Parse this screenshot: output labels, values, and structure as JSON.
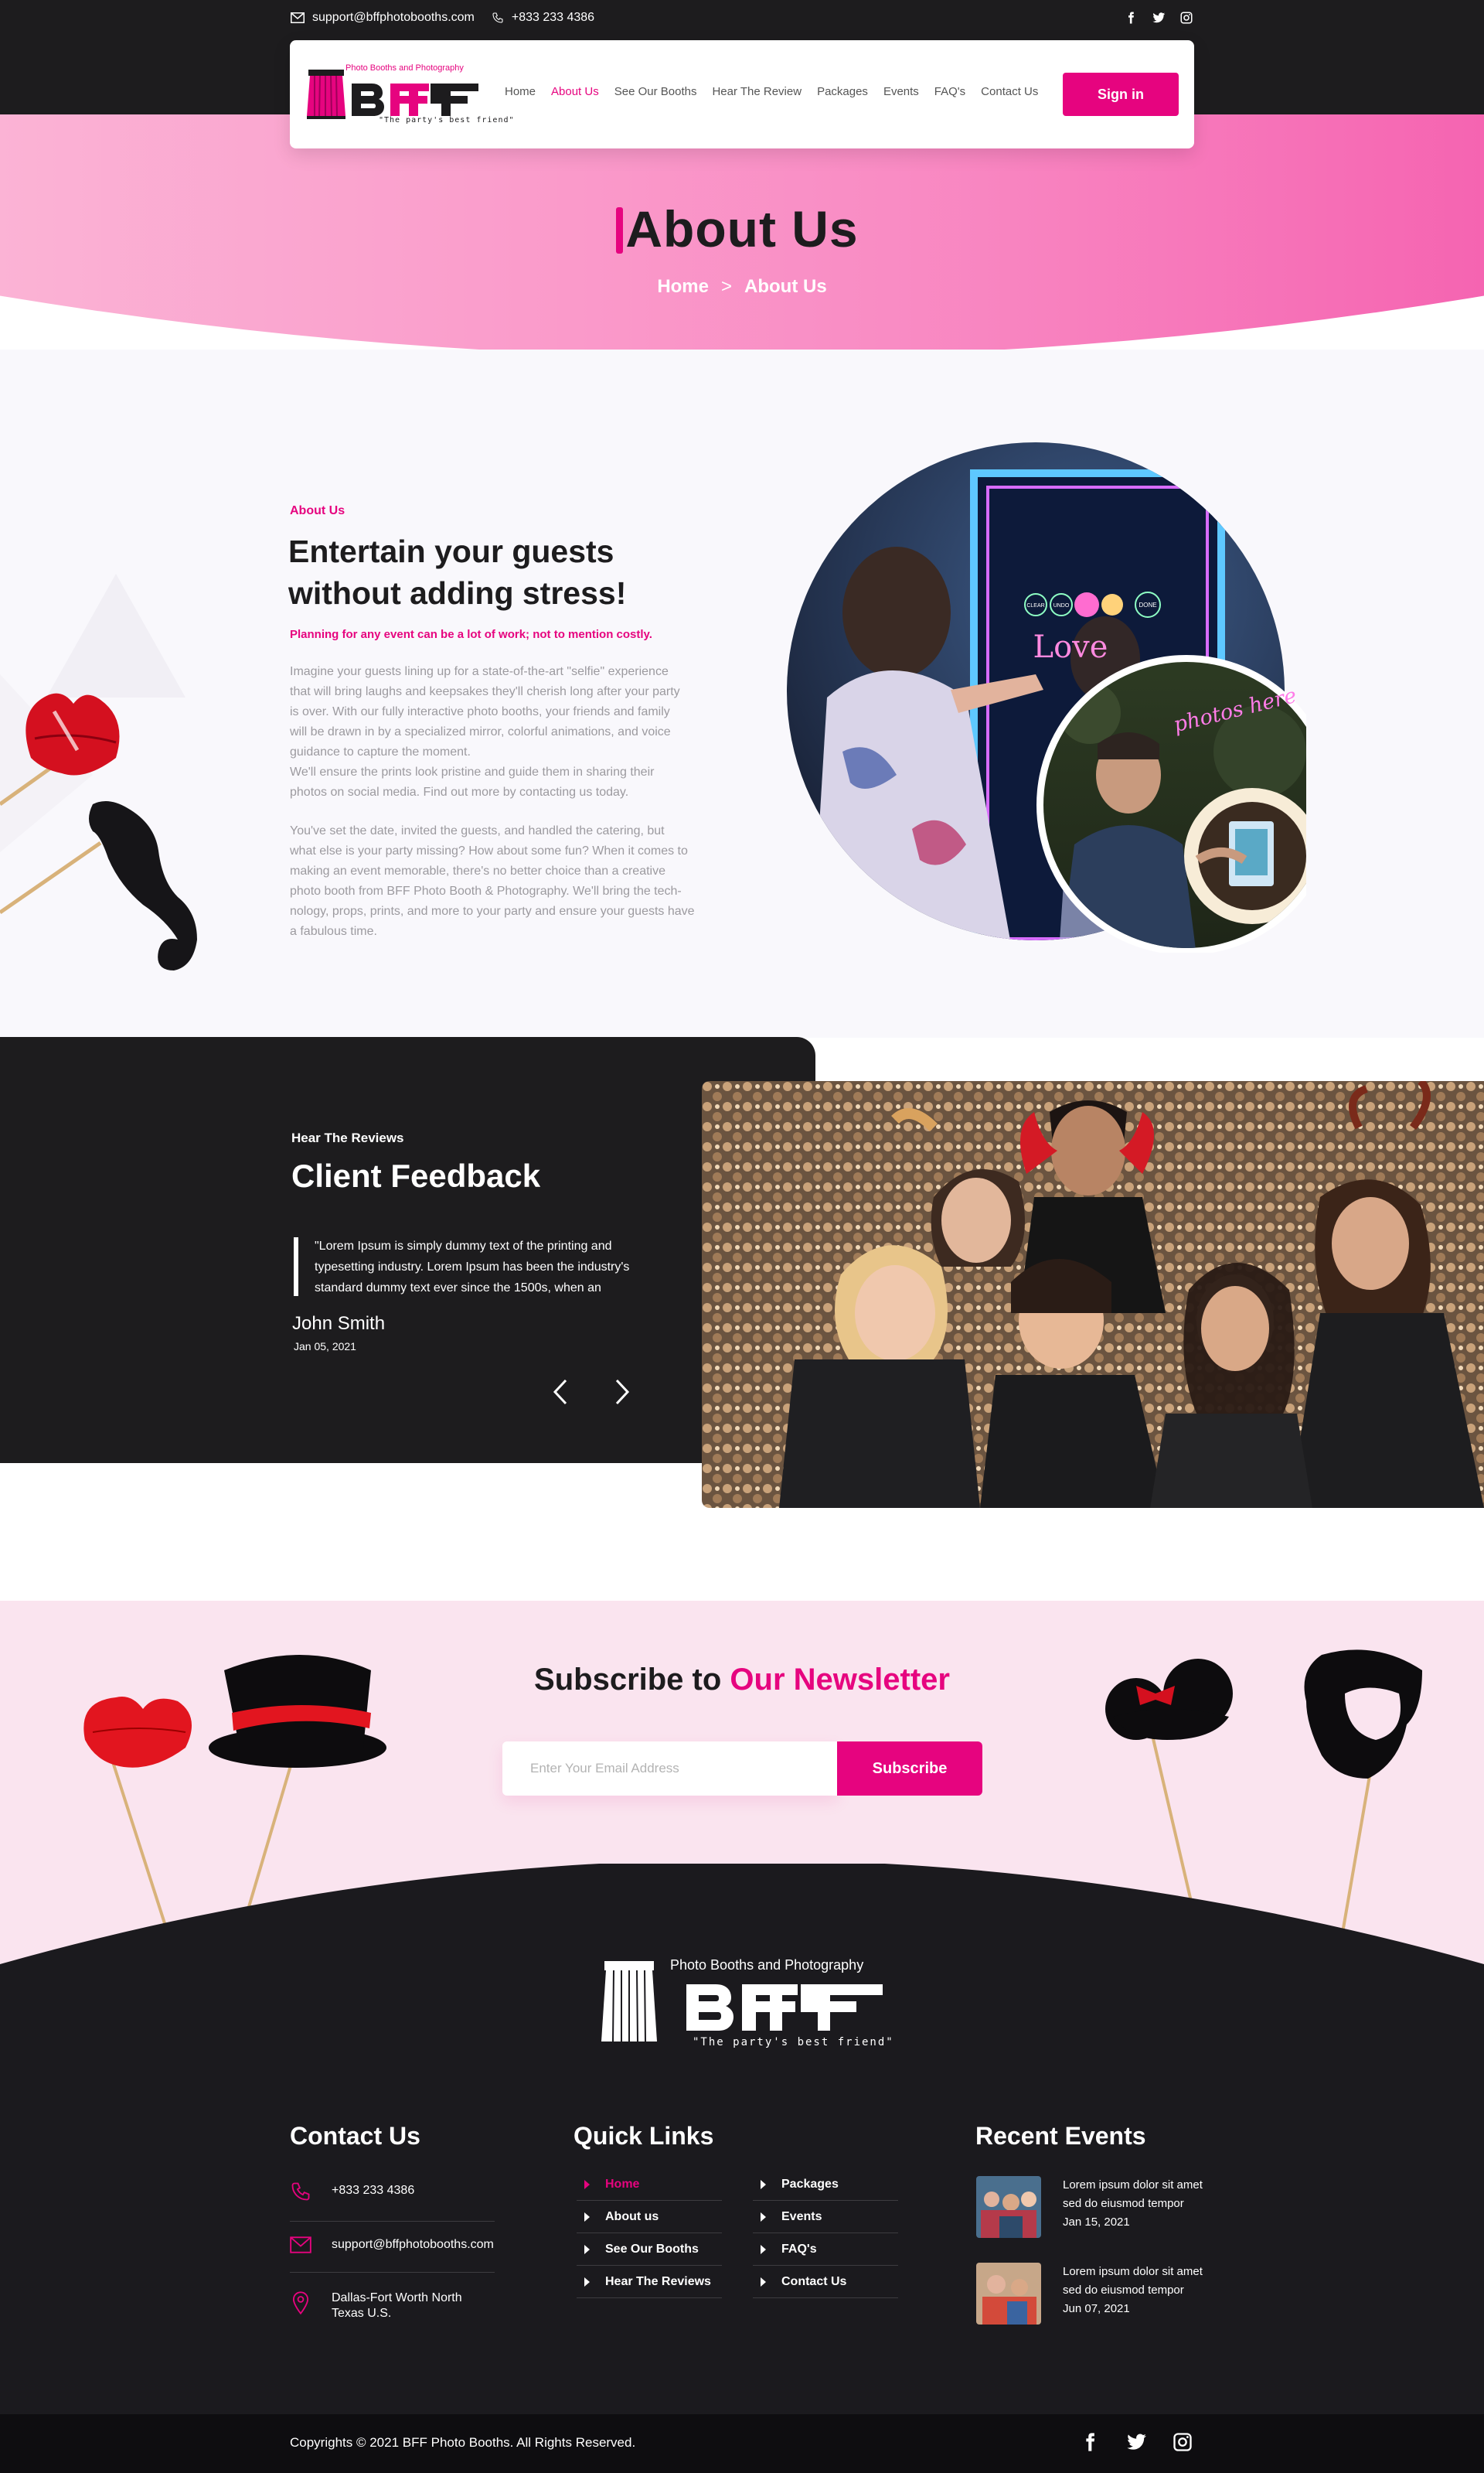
{
  "topbar": {
    "email": "support@bffphotobooths.com",
    "phone": "+833 233 4386",
    "social": [
      "facebook-icon",
      "twitter-icon",
      "instagram-icon"
    ]
  },
  "brand": {
    "tagline_top": "Photo Booths and Photography",
    "wordmark": "BFF",
    "slogan": "\"The party's best friend\""
  },
  "nav": {
    "items": [
      "Home",
      "About Us",
      "See Our Booths",
      "Hear The Review",
      "Packages",
      "Events",
      "FAQ's",
      "Contact Us"
    ],
    "active": "About Us",
    "signin": "Sign in"
  },
  "hero": {
    "title": "About Us",
    "breadcrumb": [
      "Home",
      ">",
      "About Us"
    ]
  },
  "about": {
    "eyebrow": "About Us",
    "heading_line1": "Entertain your guests",
    "heading_line2": "without adding stress!",
    "subheading": "Planning for any event can be a lot of work; not to mention costly.",
    "para1_lines": [
      "Imagine your guests lining up for a state-of-the-art \"selfie\" experience",
      "that will bring laughs and keepsakes they'll cherish long after your party",
      "is over. With our fully interactive photo booths, your friends and family",
      "will be drawn in by a specialized mirror, colorful animations, and voice",
      "guidance to capture the moment.",
      "We'll ensure the prints look pristine and guide them in sharing their",
      "photos on social media. Find out more by contacting us today."
    ],
    "para2_lines": [
      "You've set the date, invited the guests, and handled the catering, but",
      "what else is your party missing? How about some fun? When it comes to",
      "making an event memorable, there's no better choice than a creative",
      "photo booth from BFF Photo Booth & Photography. We'll bring the tech-",
      "nology, props, prints, and more to your party and ensure your guests have",
      "a fabulous time."
    ],
    "mirror_buttons": [
      "CLEAR",
      "UNDO",
      "",
      "",
      "DONE"
    ],
    "mirror_text": "Love",
    "neon_sign": "photos here"
  },
  "feedback": {
    "eyebrow": "Hear The Reviews",
    "title": "Client Feedback",
    "quote_lines": [
      "\"Lorem Ipsum is simply dummy text of the printing and",
      "typesetting industry. Lorem Ipsum has been the industry's",
      "standard dummy text ever since the 1500s, when an"
    ],
    "name": "John Smith",
    "date": "Jan 05, 2021"
  },
  "newsletter": {
    "title_plain": "Subscribe to ",
    "title_highlight": "Our Newsletter",
    "placeholder": "Enter Your Email Address",
    "button": "Subscribe"
  },
  "footer": {
    "contact_title": "Contact Us",
    "phone": "+833 233 4386",
    "email": "support@bffphotobooths.com",
    "address_line1": "Dallas-Fort Worth North",
    "address_line2": "Texas U.S.",
    "links_title": "Quick Links",
    "links_col1": [
      "Home",
      "About us",
      "See Our Booths",
      "Hear The Reviews"
    ],
    "links_col2": [
      "Packages",
      "Events",
      "FAQ's",
      "Contact Us"
    ],
    "active_link": "Home",
    "events_title": "Recent Events",
    "events": [
      {
        "line1": "Lorem ipsum dolor sit amet",
        "line2": "sed do eiusmod tempor",
        "date": "Jan 15, 2021"
      },
      {
        "line1": "Lorem ipsum dolor sit amet",
        "line2": "sed do eiusmod tempor",
        "date": "Jun 07, 2021"
      }
    ],
    "copyright": "Copyrights © 2021 BFF Photo Booths. All Rights Reserved.",
    "social": [
      "facebook-icon",
      "twitter-icon",
      "instagram-icon"
    ]
  },
  "colors": {
    "accent": "#e6047f",
    "dark": "#1d1c1e",
    "hero_pink": "#f98cc4",
    "newsletter_bg": "#fae4ef"
  }
}
